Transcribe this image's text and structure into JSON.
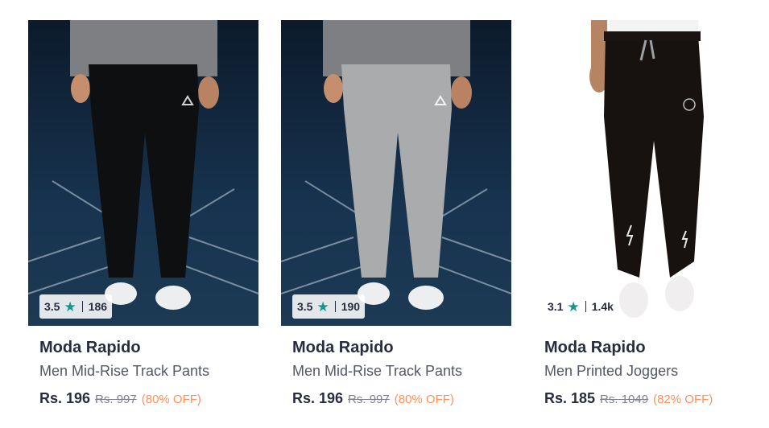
{
  "products": [
    {
      "brand": "Moda Rapido",
      "name": "Men Mid-Rise Track Pants",
      "price": "Rs. 196",
      "mrp": "Rs. 997",
      "discount": "(80% OFF)",
      "rating": "3.5",
      "rating_count": "186",
      "image_desc": "black-track-pants"
    },
    {
      "brand": "Moda Rapido",
      "name": "Men Mid-Rise Track Pants",
      "price": "Rs. 196",
      "mrp": "Rs. 997",
      "discount": "(80% OFF)",
      "rating": "3.5",
      "rating_count": "190",
      "image_desc": "grey-track-pants"
    },
    {
      "brand": "Moda Rapido",
      "name": "Men Printed Joggers",
      "price": "Rs. 185",
      "mrp": "Rs. 1049",
      "discount": "(82% OFF)",
      "rating": "3.1",
      "rating_count": "1.4k",
      "image_desc": "black-printed-joggers"
    }
  ],
  "colors": {
    "star": "#14958f",
    "discount": "#ff905a",
    "text_primary": "#282c3f",
    "text_secondary": "#535766"
  }
}
